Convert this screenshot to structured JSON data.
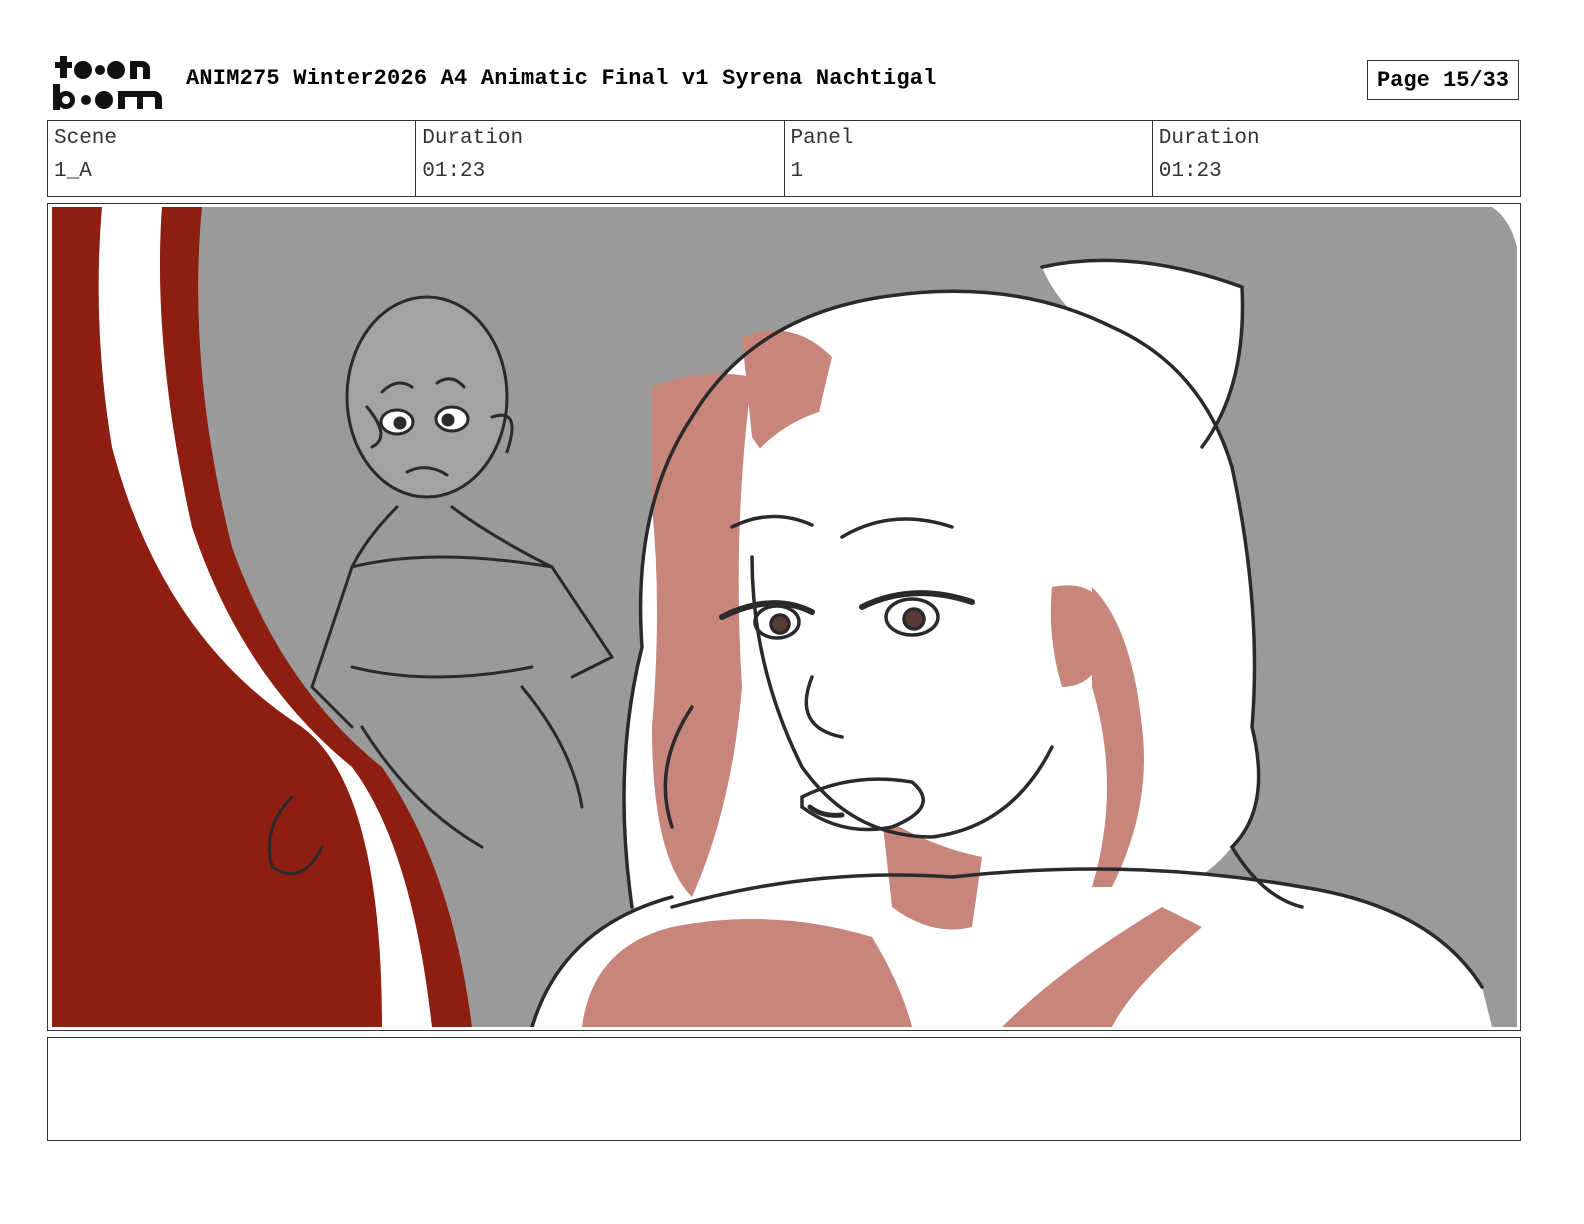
{
  "header": {
    "logo_text": "toon boom",
    "title": "ANIM275 Winter2026 A4 Animatic Final v1 Syrena Nachtigal",
    "page_label": "Page 15/33"
  },
  "info": {
    "scene_label": "Scene",
    "scene_value": "1_A",
    "scene_duration_label": "Duration",
    "scene_duration_value": "01:23",
    "panel_label": "Panel",
    "panel_value": "1",
    "panel_duration_label": "Duration",
    "panel_duration_value": "01:23"
  },
  "panel": {
    "background_color": "#9a9a9a",
    "accent_red": "#8e1e0f",
    "skin_tone": "#c8857b",
    "line_color": "#2a2a2a"
  },
  "notes": {
    "text": ""
  }
}
